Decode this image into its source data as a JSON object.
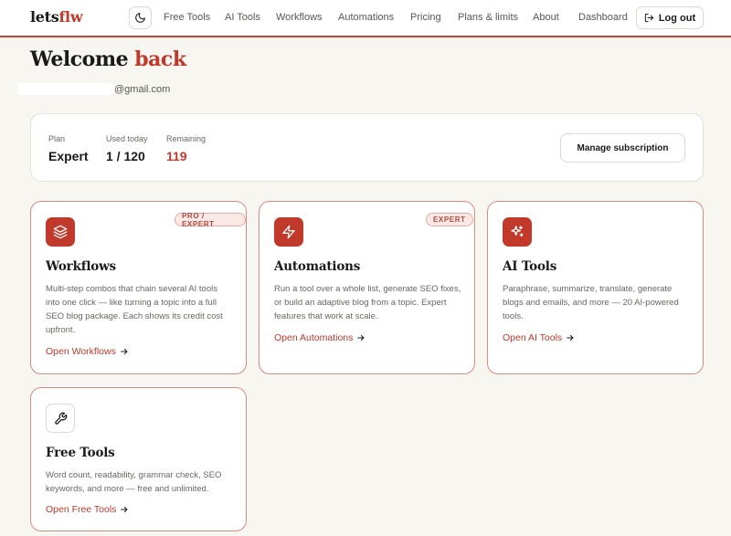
{
  "header": {
    "logo_main": "lets",
    "logo_accent": "flw",
    "nav": [
      {
        "label": "Free Tools"
      },
      {
        "label": "AI Tools"
      },
      {
        "label": "Workflows"
      },
      {
        "label": "Automations"
      },
      {
        "label": "Pricing"
      },
      {
        "label": "Plans & limits"
      },
      {
        "label": "About"
      },
      {
        "label": "Dashboard"
      }
    ],
    "logout_label": "Log out"
  },
  "welcome": {
    "greeting": "Welcome",
    "accent": "back",
    "email_suffix": "@gmail.com"
  },
  "plan": {
    "plan_label": "Plan",
    "plan_value": "Expert",
    "used_label": "Used today",
    "used_value": "1 / 120",
    "remaining_label": "Remaining",
    "remaining_value": "119",
    "manage_label": "Manage subscription"
  },
  "cards": [
    {
      "title": "Workflows",
      "badge": "PRO / EXPERT",
      "desc": "Multi-step combos that chain several AI tools into one click — like turning a topic into a full SEO blog package. Each shows its credit cost upfront.",
      "link": "Open Workflows",
      "icon": "layers-icon"
    },
    {
      "title": "Automations",
      "badge": "EXPERT",
      "desc": "Run a tool over a whole list, generate SEO fixes, or build an adaptive blog from a topic. Expert features that work at scale.",
      "link": "Open Automations",
      "icon": "lightning-icon"
    },
    {
      "title": "AI Tools",
      "desc": "Paraphrase, summarize, translate, generate blogs and emails, and more — 20 AI-powered tools.",
      "link": "Open AI Tools",
      "icon": "sparkle-icon"
    },
    {
      "title": "Free Tools",
      "desc": "Word count, readability, grammar check, SEO keywords, and more — free and unlimited.",
      "link": "Open Free Tools",
      "icon": "wrench-icon"
    }
  ],
  "colors": {
    "accent": "#c0392b",
    "background": "#f8f6f1",
    "card_border": "#d88a80"
  }
}
